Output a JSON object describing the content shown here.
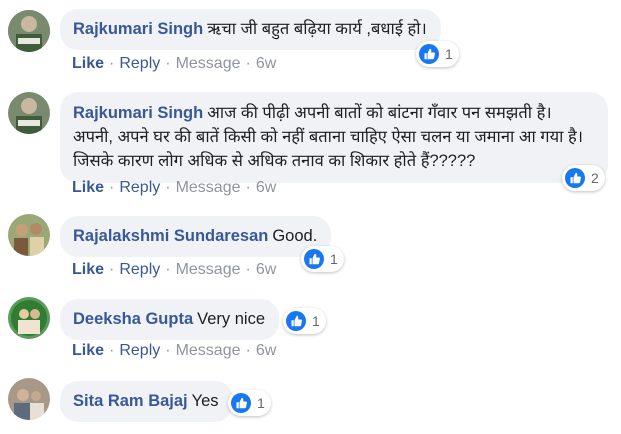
{
  "comments": [
    {
      "author": "Rajkumari Singh",
      "text": "ऋचा जी बहुत बढ़िया कार्य ,बधाई हो।",
      "like_label": "Like",
      "reply_label": "Reply",
      "message_label": "Message",
      "time": "6w",
      "reaction_count": "1",
      "avatar_colors": [
        "#6b7a5f",
        "#c9c3b5"
      ]
    },
    {
      "author": "Rajkumari Singh",
      "text": "आज की पीढ़ी अपनी बातों को बांटना गँवार पन समझती है। अपनी, अपने घर की बातें किसी को नहीं बताना चाहिए ऐसा चलन या जमाना आ गया है। जिसके कारण लोग अधिक से अधिक तनाव का शिकार होते हैं?????",
      "like_label": "Like",
      "reply_label": "Reply",
      "message_label": "Message",
      "time": "6w",
      "reaction_count": "2",
      "avatar_colors": [
        "#6b7a5f",
        "#c9c3b5"
      ]
    },
    {
      "author": "Rajalakshmi Sundaresan",
      "text": "Good.",
      "like_label": "Like",
      "reply_label": "Reply",
      "message_label": "Message",
      "time": "6w",
      "reaction_count": "1",
      "avatar_colors": [
        "#8a9b6a",
        "#d7c7a0"
      ]
    },
    {
      "author": "Deeksha Gupta",
      "text": "Very nice",
      "like_label": "Like",
      "reply_label": "Reply",
      "message_label": "Message",
      "time": "6w",
      "reaction_count": "1",
      "avatar_colors": [
        "#4a8a4a",
        "#e6d2b0"
      ]
    },
    {
      "author": "Sita Ram Bajaj",
      "text": "Yes",
      "reaction_count": "1",
      "avatar_colors": [
        "#8d7b6a",
        "#dcd2c4"
      ]
    }
  ],
  "colors": {
    "link": "#385898",
    "bubble": "#f0f2f5",
    "muted": "#90949c",
    "like_blue": "#1877f2"
  },
  "icons": {
    "reaction": "thumbs-up-icon",
    "avatar": "user-avatar"
  }
}
